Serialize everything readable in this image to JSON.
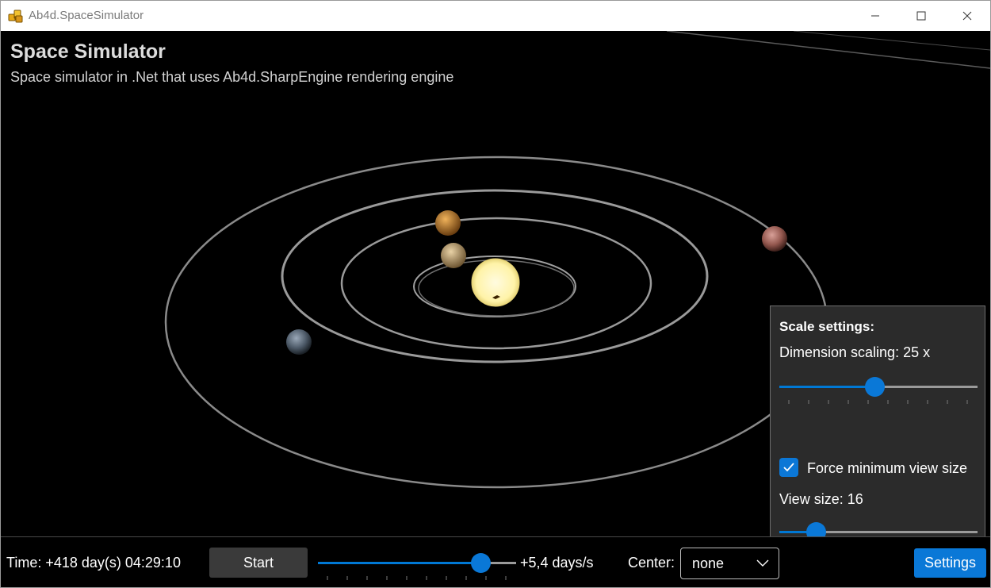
{
  "window": {
    "title": "Ab4d.SpaceSimulator",
    "icon": "puzzle-pieces-icon",
    "controls": [
      "minimize-icon",
      "maximize-icon",
      "close-icon"
    ]
  },
  "overlay": {
    "title": "Space Simulator",
    "subtitle": "Space simulator in .Net that uses Ab4d.SharpEngine rendering engine"
  },
  "scene": {
    "background": "#000000",
    "orbit_color": "#8c8c8c",
    "sun_color": "#fff5b0",
    "bodies": [
      "Sun",
      "Mercury",
      "Venus",
      "Earth",
      "Mars"
    ]
  },
  "scale_panel": {
    "heading": "Scale settings:",
    "dimension_label": "Dimension scaling: 25 x",
    "dimension_level": 0.48,
    "force_label": "Force minimum view size",
    "force_checked": true,
    "view_size_label": "View size: 16",
    "view_size_level": 0.19
  },
  "bottom": {
    "time": "Time: +418 day(s) 04:29:10",
    "start_label": "Start",
    "speed_level": 0.82,
    "speed_text": "+5,4 days/s",
    "center_label": "Center:",
    "center_value": "none",
    "settings_label": "Settings"
  },
  "colors": {
    "accent": "#0a78d7",
    "panel_bg": "#2b2b2b",
    "button_bg": "#3a3a3a"
  }
}
